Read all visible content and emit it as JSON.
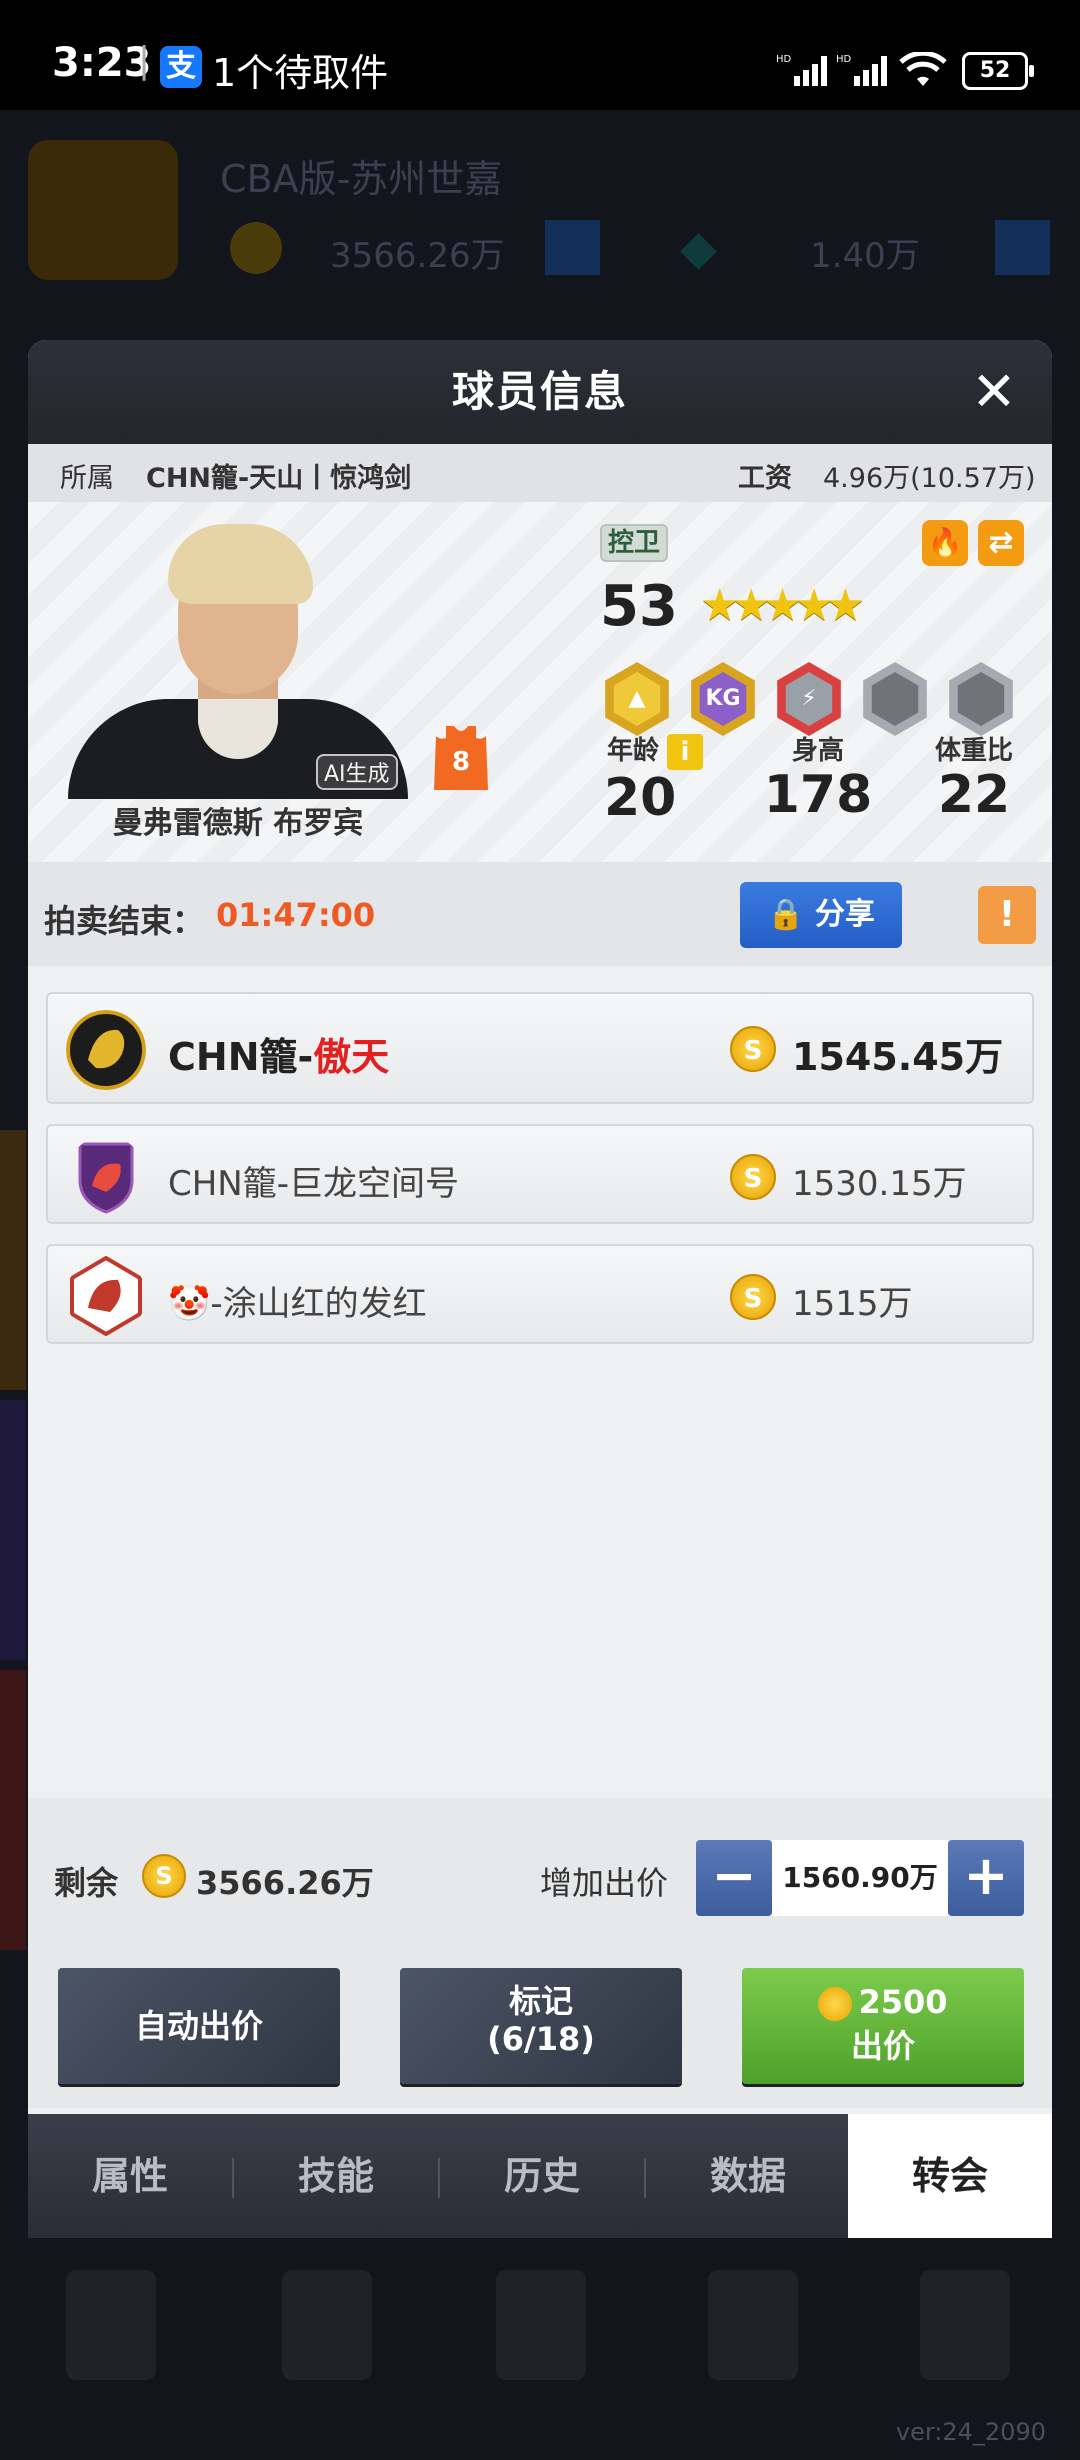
{
  "status_bar": {
    "time": "3:23",
    "notification": "1个待取件",
    "pay_icon_glyph": "支",
    "battery": "52"
  },
  "background": {
    "title": "CBA版-苏州世嘉",
    "money1": "3566.26万",
    "money2": "1.40万"
  },
  "version": "ver:24_2090",
  "modal": {
    "title": "球员信息",
    "close_glyph": "✕"
  },
  "info_row": {
    "team_label": "所属",
    "team": "CHN籠-天山丨惊鸿剑",
    "salary_label": "工资",
    "salary": "4.96万(10.57万)"
  },
  "player": {
    "name": "曼弗雷德斯 布罗宾",
    "ai_tag": "AI生成",
    "jersey_number": "8",
    "position": "控卫",
    "rating": "53",
    "stars_value": 4.5,
    "stars_max": 5,
    "stars_glyphs": "★★★★★",
    "badge_icons": [
      "gold-badge-icon",
      "kg-badge-icon",
      "red-badge-icon",
      "gray-badge-icon",
      "gray-badge-icon"
    ],
    "kg_text": "KG",
    "stats": [
      {
        "label": "年龄",
        "value": "20"
      },
      {
        "label": "身高",
        "value": "178"
      },
      {
        "label": "体重比",
        "value": "22"
      }
    ],
    "info_glyph": "i"
  },
  "auction": {
    "label": "拍卖结束：",
    "timer": "01:47:00",
    "share_label": "分享",
    "lock_glyph": "🔒",
    "warn_glyph": "!"
  },
  "bids": [
    {
      "team_prefix": "CHN籠-",
      "team_highlight": "傲天",
      "amount": "1545.45万"
    },
    {
      "team_prefix": "CHN籠-巨龙空间号",
      "team_highlight": "",
      "amount": "1530.15万"
    },
    {
      "team_prefix": "🤡-涂山红的发红",
      "team_highlight": "",
      "amount": "1515万"
    }
  ],
  "coin_glyph": "S",
  "bottom": {
    "remain_label": "剩余",
    "remain_value": "3566.26万",
    "increase_label": "增加出价",
    "bid_value": "1560.90万",
    "minus_glyph": "−",
    "plus_glyph": "+",
    "auto_bid": "自动出价",
    "mark_line1": "标记",
    "mark_line2": "(6/18)",
    "bid_amount": "2500",
    "bid_label": "出价"
  },
  "tabs": [
    "属性",
    "技能",
    "历史",
    "数据",
    "转会"
  ],
  "active_tab": "转会",
  "colors": {
    "accent_orange": "#ef5a22",
    "highlight_red": "#e32020",
    "bid_green": "#5fb436",
    "share_blue": "#2f6fd6"
  }
}
